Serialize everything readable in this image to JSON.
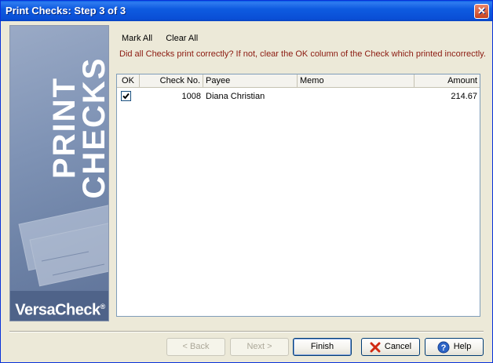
{
  "window": {
    "title": "Print Checks: Step 3 of 3"
  },
  "banner": {
    "title_line1": "PRINT",
    "title_line2": "CHECKS",
    "logo": "VersaCheck",
    "logo_mark": "®"
  },
  "toolbar": {
    "mark_all": "Mark All",
    "clear_all": "Clear All"
  },
  "instruction": "Did all Checks print correctly? If not, clear the OK column of the Check which printed incorrectly.",
  "grid": {
    "columns": [
      "OK",
      "Check No.",
      "Payee",
      "Memo",
      "Amount"
    ],
    "rows": [
      {
        "ok": true,
        "check_no": "1008",
        "payee": "Diana Christian",
        "memo": "",
        "amount": "214.67"
      }
    ]
  },
  "buttons": {
    "back": "< Back",
    "next": "Next >",
    "finish": "Finish",
    "cancel": "Cancel",
    "help": "Help"
  },
  "colors": {
    "instruction_text": "#8B1A10",
    "title_bar": "#0A4FD6",
    "banner": "#7F93B5"
  }
}
